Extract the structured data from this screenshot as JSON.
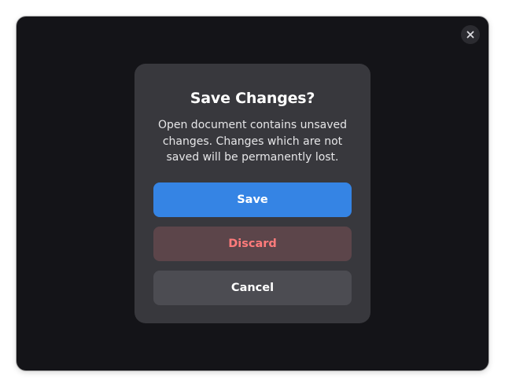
{
  "window": {
    "close_icon": "close-icon"
  },
  "dialog": {
    "title": "Save Changes?",
    "body": "Open document contains unsaved changes. Changes which are not saved will be permanently lost.",
    "buttons": {
      "save_label": "Save",
      "discard_label": "Discard",
      "cancel_label": "Cancel"
    }
  },
  "colors": {
    "window_bg": "#141418",
    "dialog_bg": "#38383d",
    "accent": "#3584e4",
    "destructive_text": "#ff7b7b",
    "destructive_bg": "#5c454a",
    "neutral_bg": "#4c4c52"
  }
}
